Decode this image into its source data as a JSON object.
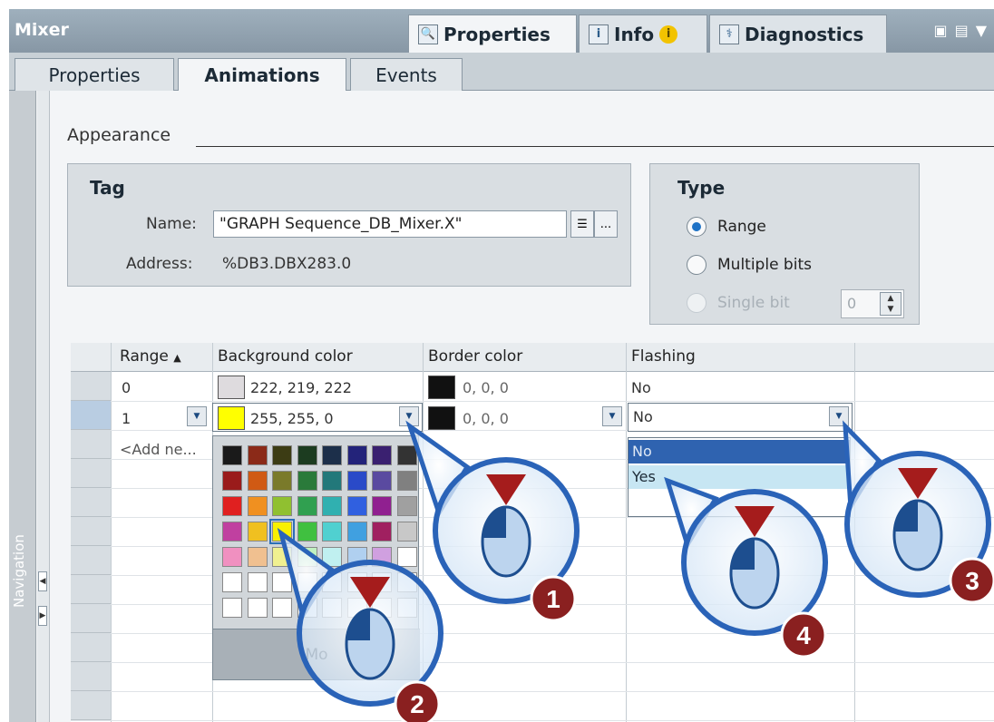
{
  "window": {
    "title": "Mixer",
    "panel_tabs": [
      {
        "label": "Properties",
        "icon": "magnifier-icon"
      },
      {
        "label": "Info",
        "icon": "info-icon"
      },
      {
        "label": "Diagnostics",
        "icon": "diagnostics-icon"
      }
    ]
  },
  "subtabs": [
    "Properties",
    "Animations",
    "Events"
  ],
  "navigation_label": "Navigation",
  "section": {
    "title": "Appearance"
  },
  "tag_group": {
    "title": "Tag",
    "name_label": "Name:",
    "name_value": "\"GRAPH Sequence_DB_Mixer.X\"",
    "address_label": "Address:",
    "address_value": "%DB3.DBX283.0"
  },
  "type_group": {
    "title": "Type",
    "options": [
      {
        "label": "Range",
        "checked": true,
        "enabled": true
      },
      {
        "label": "Multiple bits",
        "checked": false,
        "enabled": true
      },
      {
        "label": "Single bit",
        "checked": false,
        "enabled": false
      }
    ],
    "single_bit_value": "0"
  },
  "table": {
    "columns": [
      "Range",
      "Background color",
      "Border color",
      "Flashing"
    ],
    "rows": [
      {
        "range": "0",
        "bg": "222, 219, 222",
        "bg_color": "#dedbde",
        "border": "0, 0, 0",
        "border_color": "#000000",
        "flashing": "No"
      },
      {
        "range": "1",
        "bg": "255, 255, 0",
        "bg_color": "#ffff00",
        "border": "0, 0, 0",
        "border_color": "#000000",
        "flashing": "No"
      }
    ],
    "add_new": "<Add ne..."
  },
  "palette": {
    "colors": [
      "#1a1a1a",
      "#8b2a18",
      "#3c3c14",
      "#1c3c20",
      "#1c2f4a",
      "#23237a",
      "#3a2070",
      "#333333",
      "#9a1b1b",
      "#d05a14",
      "#7a7a2a",
      "#2a7a3a",
      "#22787a",
      "#2a4ac8",
      "#5a4aa0",
      "#808080",
      "#e02020",
      "#f09020",
      "#90c030",
      "#30a050",
      "#30b0b0",
      "#3060e0",
      "#902090",
      "#a0a0a0",
      "#c040a0",
      "#f0c020",
      "#f8f000",
      "#40c040",
      "#50d0d0",
      "#40a0e0",
      "#a02060",
      "#c8c8c8",
      "#f090c0",
      "#f0c090",
      "#f0f090",
      "#c0f0c0",
      "#c0f0f0",
      "#b0d0f0",
      "#d0a0e0",
      "#ffffff",
      "#ffffff",
      "#ffffff",
      "#ffffff",
      "#ffffff",
      "#ffffff",
      "#ffffff",
      "#ffffff",
      "#ffffff",
      "#ffffff",
      "#ffffff",
      "#ffffff",
      "#ffffff",
      "#ffffff",
      "#ffffff",
      "#ffffff",
      "#ffffff"
    ],
    "selected_index": 26,
    "more_label": "Mo"
  },
  "flashing_options": [
    "No",
    "Yes"
  ],
  "flashing_selected": "No",
  "callouts": [
    "1",
    "2",
    "3",
    "4"
  ],
  "colors": {
    "accent": "#2f63b0",
    "callout_ring": "#2a63b8",
    "callout_badge": "#8a2020"
  }
}
